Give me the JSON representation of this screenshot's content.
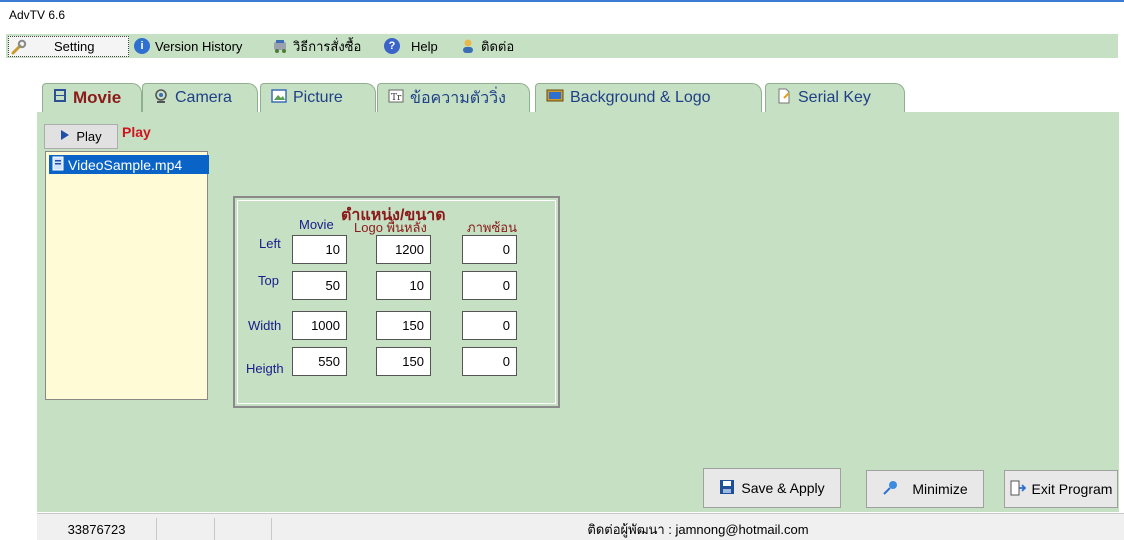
{
  "window": {
    "title": "AdvTV 6.6"
  },
  "menu": {
    "items": [
      {
        "label": "Setting",
        "icon": "wrench-icon"
      },
      {
        "label": "Version History",
        "icon": "info-icon"
      },
      {
        "label": "วิธีการสั่งซื้อ",
        "icon": "cart-icon"
      },
      {
        "label": "Help",
        "icon": "help-icon"
      },
      {
        "label": "ติดต่อ",
        "icon": "user-icon"
      }
    ]
  },
  "tabs": [
    {
      "label": "Movie",
      "icon": "film-icon"
    },
    {
      "label": "Camera",
      "icon": "webcam-icon"
    },
    {
      "label": "Picture",
      "icon": "picture-icon"
    },
    {
      "label": "ข้อความตัววิ่ง",
      "icon": "text-icon"
    },
    {
      "label": "Background & Logo",
      "icon": "monitor-icon"
    },
    {
      "label": "Serial Key",
      "icon": "document-icon"
    }
  ],
  "movie": {
    "play_button": "Play",
    "play_status": "Play",
    "files": [
      "VideoSample.mp4"
    ]
  },
  "position_panel": {
    "title": "ตำแหน่ง/ขนาด",
    "columns": [
      "Movie",
      "Logo พื้นหลัง",
      "ภาพซ้อน"
    ],
    "rows": [
      {
        "label": "Left",
        "values": [
          "10",
          "1200",
          "0"
        ]
      },
      {
        "label": "Top",
        "values": [
          "50",
          "10",
          "0"
        ]
      },
      {
        "label": "Width",
        "values": [
          "1000",
          "150",
          "0"
        ]
      },
      {
        "label": "Heigth",
        "values": [
          "550",
          "150",
          "0"
        ]
      }
    ]
  },
  "actions": {
    "save": "Save & Apply",
    "minimize": "Minimize",
    "exit": "Exit Program"
  },
  "status": {
    "code": "33876723",
    "contact": "ติดต่อผู้พัฒนา  : jamnong@hotmail.com"
  }
}
